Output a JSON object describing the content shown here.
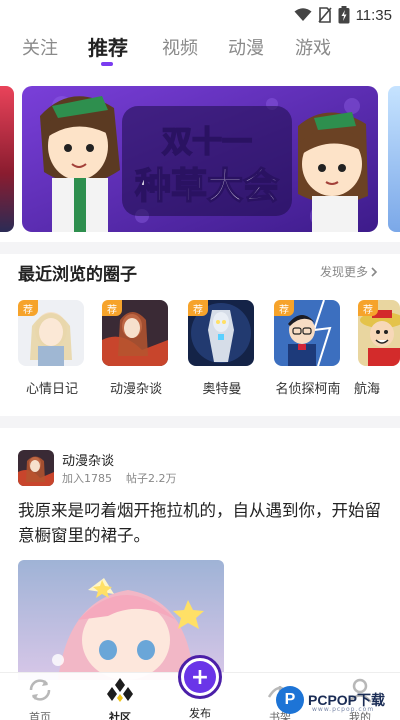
{
  "status_bar": {
    "time": "11:35"
  },
  "tabs": [
    {
      "label": "关注",
      "active": false
    },
    {
      "label": "推荐",
      "active": true
    },
    {
      "label": "视频",
      "active": false
    },
    {
      "label": "动漫",
      "active": false
    },
    {
      "label": "游戏",
      "active": false
    }
  ],
  "banner": {
    "text_line1": "双十一",
    "text_line2": "种草大会"
  },
  "recent": {
    "title": "最近浏览的圈子",
    "more": "发现更多",
    "badge": "荐",
    "items": [
      {
        "label": "心情日记"
      },
      {
        "label": "动漫杂谈"
      },
      {
        "label": "奥特曼"
      },
      {
        "label": "名侦探柯南"
      },
      {
        "label": "航海"
      }
    ]
  },
  "post": {
    "circle_name": "动漫杂谈",
    "joined": "加入1785",
    "posts": "帖子2.2万",
    "text": "我原来是叼着烟开拖拉机的，自从遇到你，开始留意橱窗里的裙子。"
  },
  "bottom_nav": {
    "home": "首页",
    "community": "社区",
    "publish": "发布",
    "bookshelf": "书架",
    "mine": "我的"
  },
  "watermark": {
    "logo": "P",
    "text": "PCPOP下载",
    "sub": "www.pcpop.com"
  },
  "colors": {
    "accent": "#6a35e8",
    "badge": "#f6a32b",
    "banner_bg": "#5a2bb8"
  }
}
